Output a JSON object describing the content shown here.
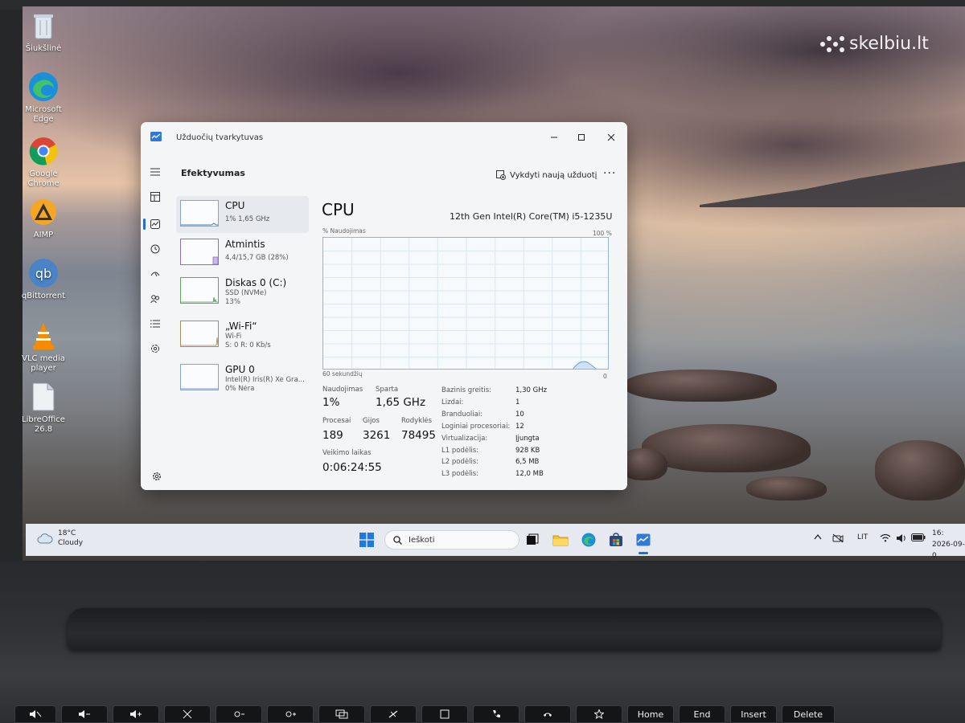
{
  "desktop_icons": [
    {
      "label": "Šiukšlinė",
      "icon": "recycle-bin-icon"
    },
    {
      "label": "Microsoft Edge",
      "icon": "edge-icon"
    },
    {
      "label": "Google Chrome",
      "icon": "chrome-icon"
    },
    {
      "label": "AIMP",
      "icon": "aimp-icon"
    },
    {
      "label": "qBittorrent",
      "icon": "qbittorrent-icon"
    },
    {
      "label": "VLC media player",
      "icon": "vlc-icon"
    },
    {
      "label": "LibreOffice 26.8",
      "icon": "libreoffice-icon"
    }
  ],
  "watermark": "skelbiu.lt",
  "window": {
    "title": "Užduočių tvarkytuvas",
    "header": "Efektyvumas",
    "run_task_label": "Vykdyti naują užduotį",
    "more": "···"
  },
  "side_items": [
    {
      "name": "CPU",
      "lines": [
        "1% 1,65 GHz"
      ]
    },
    {
      "name": "Atmintis",
      "lines": [
        "4,4/15,7 GB (28%)"
      ]
    },
    {
      "name": "Diskas 0 (C:)",
      "lines": [
        "SSD (NVMe)",
        "13%"
      ]
    },
    {
      "name": "„Wi-Fi“",
      "lines": [
        "Wi-Fi",
        "S: 0 R: 0 Kb/s"
      ]
    },
    {
      "name": "GPU 0",
      "lines": [
        "Intel(R) Iris(R) Xe Gra...",
        "0% Nėra"
      ]
    }
  ],
  "cpu": {
    "title": "CPU",
    "model": "12th Gen Intel(R) Core(TM) i5-1235U",
    "graph_ylabel": "% Naudojimas",
    "graph_max": "100 %",
    "graph_xlabel": "60 sekundžių",
    "graph_min": "0",
    "usage_label": "Naudojimas",
    "usage_value": "1%",
    "speed_label": "Sparta",
    "speed_value": "1,65 GHz",
    "processes_label": "Procesai",
    "processes_value": "189",
    "threads_label": "Gijos",
    "threads_value": "3261",
    "handles_label": "Rodyklės",
    "handles_value": "78495",
    "uptime_label": "Veikimo laikas",
    "uptime_value": "0:06:24:55",
    "details": [
      {
        "k": "Bazinis greitis:",
        "v": "1,30 GHz"
      },
      {
        "k": "Lizdai:",
        "v": "1"
      },
      {
        "k": "Branduoliai:",
        "v": "10"
      },
      {
        "k": "Loginiai procesoriai:",
        "v": "12"
      },
      {
        "k": "Virtualizacija:",
        "v": "Įjungta"
      },
      {
        "k": "L1 podėlis:",
        "v": "928 KB"
      },
      {
        "k": "L2 podėlis:",
        "v": "6,5 MB"
      },
      {
        "k": "L3 podėlis:",
        "v": "12,0 MB"
      }
    ]
  },
  "taskbar": {
    "temperature": "18°C",
    "weather": "Cloudy",
    "search_placeholder": "Ieškoti",
    "lang": "LIT",
    "time": "16:",
    "date": "2026-09-0"
  },
  "keyboard": {
    "home": "Home",
    "end": "End",
    "insert": "Insert",
    "delete": "Delete"
  }
}
